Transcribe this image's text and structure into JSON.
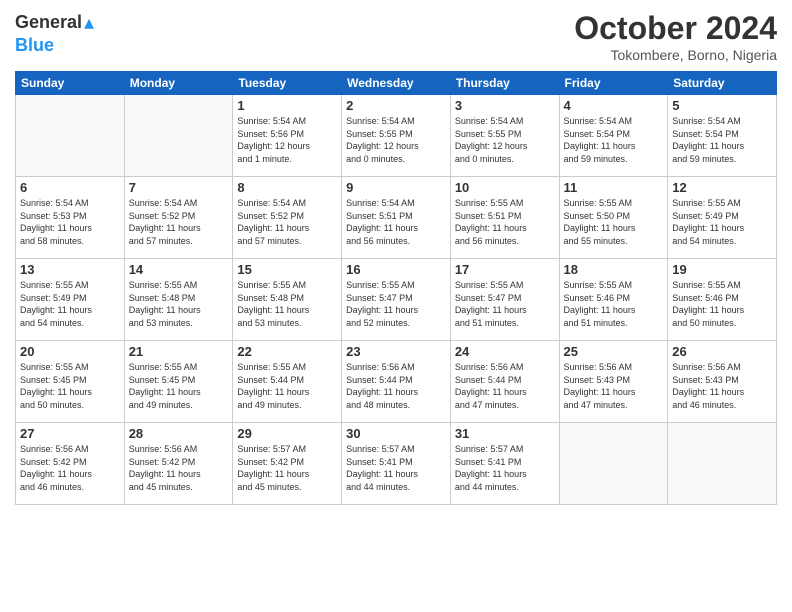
{
  "logo": {
    "general": "General",
    "blue": "Blue"
  },
  "title": "October 2024",
  "location": "Tokombere, Borno, Nigeria",
  "headers": [
    "Sunday",
    "Monday",
    "Tuesday",
    "Wednesday",
    "Thursday",
    "Friday",
    "Saturday"
  ],
  "weeks": [
    [
      {
        "day": "",
        "info": ""
      },
      {
        "day": "",
        "info": ""
      },
      {
        "day": "1",
        "info": "Sunrise: 5:54 AM\nSunset: 5:56 PM\nDaylight: 12 hours\nand 1 minute."
      },
      {
        "day": "2",
        "info": "Sunrise: 5:54 AM\nSunset: 5:55 PM\nDaylight: 12 hours\nand 0 minutes."
      },
      {
        "day": "3",
        "info": "Sunrise: 5:54 AM\nSunset: 5:55 PM\nDaylight: 12 hours\nand 0 minutes."
      },
      {
        "day": "4",
        "info": "Sunrise: 5:54 AM\nSunset: 5:54 PM\nDaylight: 11 hours\nand 59 minutes."
      },
      {
        "day": "5",
        "info": "Sunrise: 5:54 AM\nSunset: 5:54 PM\nDaylight: 11 hours\nand 59 minutes."
      }
    ],
    [
      {
        "day": "6",
        "info": "Sunrise: 5:54 AM\nSunset: 5:53 PM\nDaylight: 11 hours\nand 58 minutes."
      },
      {
        "day": "7",
        "info": "Sunrise: 5:54 AM\nSunset: 5:52 PM\nDaylight: 11 hours\nand 57 minutes."
      },
      {
        "day": "8",
        "info": "Sunrise: 5:54 AM\nSunset: 5:52 PM\nDaylight: 11 hours\nand 57 minutes."
      },
      {
        "day": "9",
        "info": "Sunrise: 5:54 AM\nSunset: 5:51 PM\nDaylight: 11 hours\nand 56 minutes."
      },
      {
        "day": "10",
        "info": "Sunrise: 5:55 AM\nSunset: 5:51 PM\nDaylight: 11 hours\nand 56 minutes."
      },
      {
        "day": "11",
        "info": "Sunrise: 5:55 AM\nSunset: 5:50 PM\nDaylight: 11 hours\nand 55 minutes."
      },
      {
        "day": "12",
        "info": "Sunrise: 5:55 AM\nSunset: 5:49 PM\nDaylight: 11 hours\nand 54 minutes."
      }
    ],
    [
      {
        "day": "13",
        "info": "Sunrise: 5:55 AM\nSunset: 5:49 PM\nDaylight: 11 hours\nand 54 minutes."
      },
      {
        "day": "14",
        "info": "Sunrise: 5:55 AM\nSunset: 5:48 PM\nDaylight: 11 hours\nand 53 minutes."
      },
      {
        "day": "15",
        "info": "Sunrise: 5:55 AM\nSunset: 5:48 PM\nDaylight: 11 hours\nand 53 minutes."
      },
      {
        "day": "16",
        "info": "Sunrise: 5:55 AM\nSunset: 5:47 PM\nDaylight: 11 hours\nand 52 minutes."
      },
      {
        "day": "17",
        "info": "Sunrise: 5:55 AM\nSunset: 5:47 PM\nDaylight: 11 hours\nand 51 minutes."
      },
      {
        "day": "18",
        "info": "Sunrise: 5:55 AM\nSunset: 5:46 PM\nDaylight: 11 hours\nand 51 minutes."
      },
      {
        "day": "19",
        "info": "Sunrise: 5:55 AM\nSunset: 5:46 PM\nDaylight: 11 hours\nand 50 minutes."
      }
    ],
    [
      {
        "day": "20",
        "info": "Sunrise: 5:55 AM\nSunset: 5:45 PM\nDaylight: 11 hours\nand 50 minutes."
      },
      {
        "day": "21",
        "info": "Sunrise: 5:55 AM\nSunset: 5:45 PM\nDaylight: 11 hours\nand 49 minutes."
      },
      {
        "day": "22",
        "info": "Sunrise: 5:55 AM\nSunset: 5:44 PM\nDaylight: 11 hours\nand 49 minutes."
      },
      {
        "day": "23",
        "info": "Sunrise: 5:56 AM\nSunset: 5:44 PM\nDaylight: 11 hours\nand 48 minutes."
      },
      {
        "day": "24",
        "info": "Sunrise: 5:56 AM\nSunset: 5:44 PM\nDaylight: 11 hours\nand 47 minutes."
      },
      {
        "day": "25",
        "info": "Sunrise: 5:56 AM\nSunset: 5:43 PM\nDaylight: 11 hours\nand 47 minutes."
      },
      {
        "day": "26",
        "info": "Sunrise: 5:56 AM\nSunset: 5:43 PM\nDaylight: 11 hours\nand 46 minutes."
      }
    ],
    [
      {
        "day": "27",
        "info": "Sunrise: 5:56 AM\nSunset: 5:42 PM\nDaylight: 11 hours\nand 46 minutes."
      },
      {
        "day": "28",
        "info": "Sunrise: 5:56 AM\nSunset: 5:42 PM\nDaylight: 11 hours\nand 45 minutes."
      },
      {
        "day": "29",
        "info": "Sunrise: 5:57 AM\nSunset: 5:42 PM\nDaylight: 11 hours\nand 45 minutes."
      },
      {
        "day": "30",
        "info": "Sunrise: 5:57 AM\nSunset: 5:41 PM\nDaylight: 11 hours\nand 44 minutes."
      },
      {
        "day": "31",
        "info": "Sunrise: 5:57 AM\nSunset: 5:41 PM\nDaylight: 11 hours\nand 44 minutes."
      },
      {
        "day": "",
        "info": ""
      },
      {
        "day": "",
        "info": ""
      }
    ]
  ]
}
